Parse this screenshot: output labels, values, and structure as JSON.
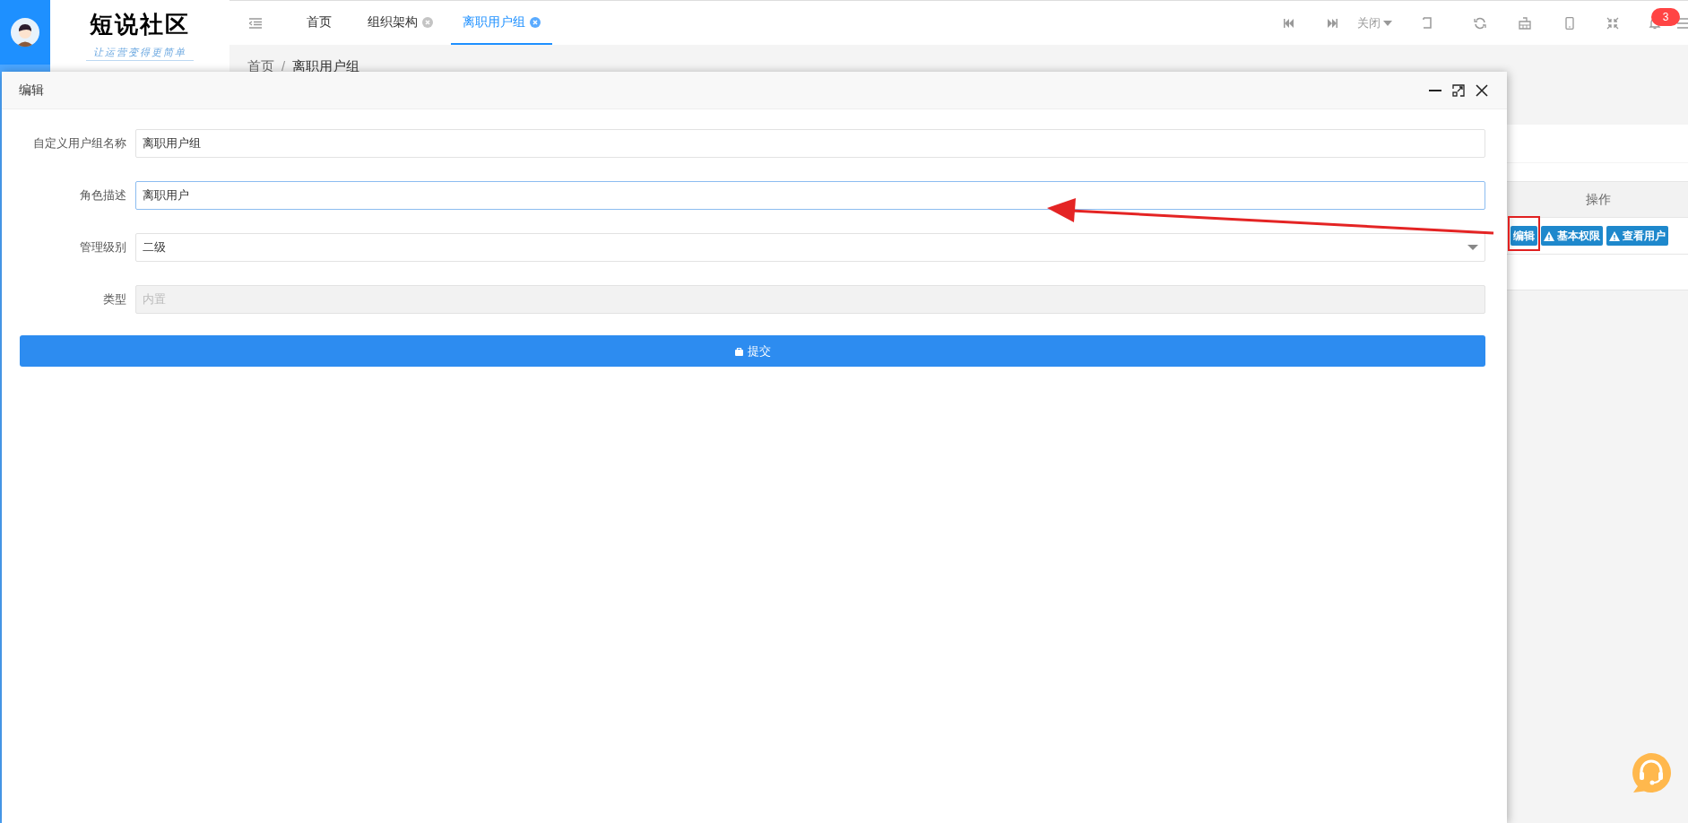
{
  "logo": {
    "title": "短说社区",
    "slogan": "让运营变得更简单"
  },
  "tabs": [
    {
      "label": "首页",
      "closable": false,
      "selected": false
    },
    {
      "label": "组织架构",
      "closable": true,
      "selected": false
    },
    {
      "label": "离职用户组",
      "closable": true,
      "selected": true
    }
  ],
  "toolbar": {
    "close_menu": "关闭",
    "notification_count": "3"
  },
  "breadcrumb": {
    "separator": "/",
    "items": [
      "首页",
      "离职用户组"
    ]
  },
  "table": {
    "columns": [
      "操作"
    ],
    "rows": [
      {
        "actions": [
          {
            "label": "编辑",
            "kind": "edit"
          },
          {
            "label": "基本权限",
            "kind": "warning"
          },
          {
            "label": "查看用户",
            "kind": "warning"
          }
        ]
      }
    ]
  },
  "dialog": {
    "title": "编辑",
    "fields": [
      {
        "kind": "text",
        "label": "自定义用户组名称",
        "value": "离职用户组",
        "focused": false,
        "disabled": false
      },
      {
        "kind": "text",
        "label": "角色描述",
        "value": "离职用户",
        "focused": true,
        "disabled": false
      },
      {
        "kind": "select",
        "label": "管理级别",
        "value": "二级",
        "focused": false,
        "disabled": false
      },
      {
        "kind": "text",
        "label": "类型",
        "value": "内置",
        "focused": false,
        "disabled": true
      }
    ],
    "submit": "提交"
  }
}
